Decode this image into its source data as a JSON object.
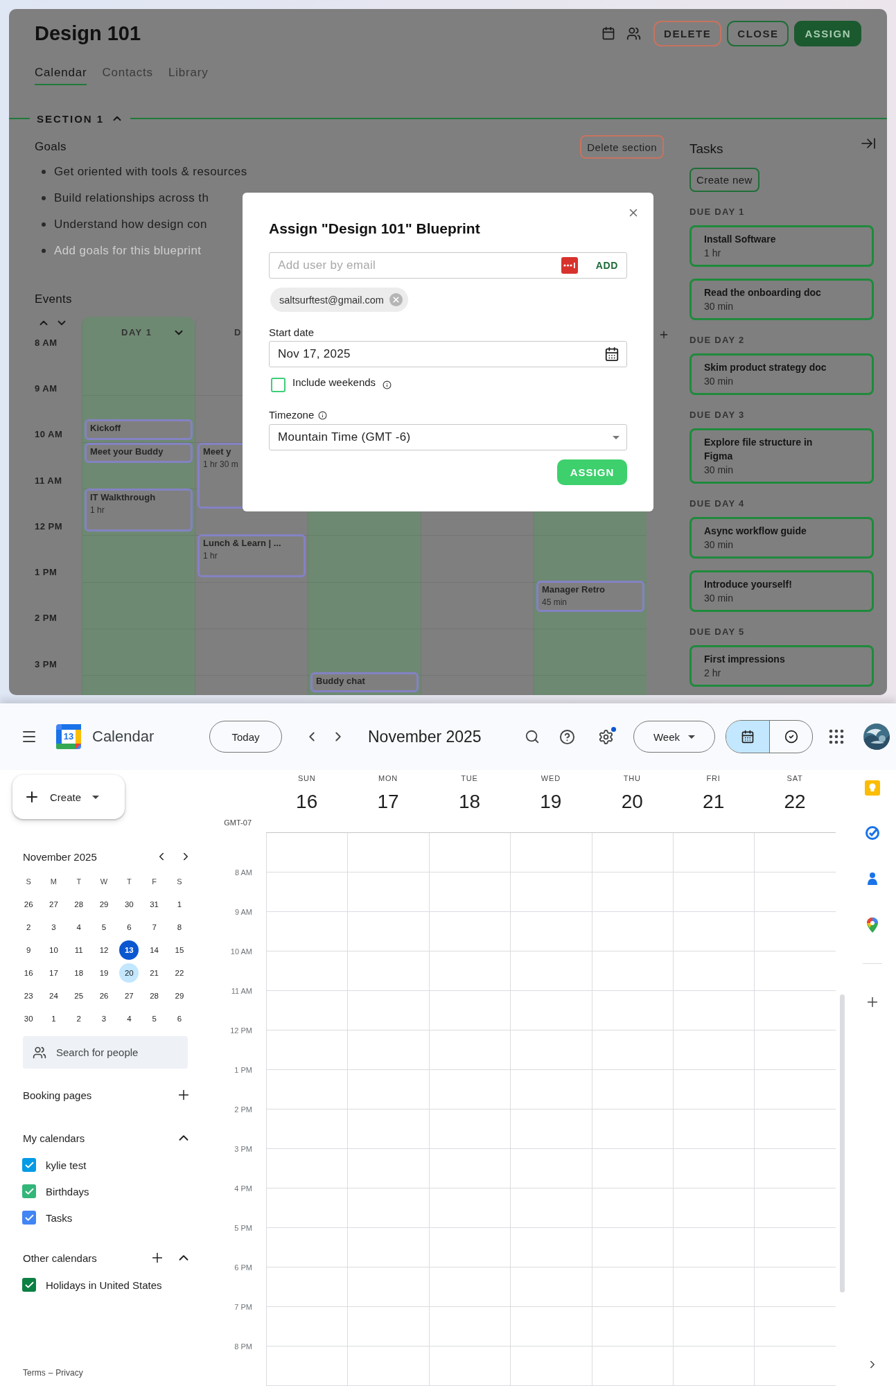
{
  "blueprint": {
    "title": "Design 101",
    "header_buttons": [
      {
        "label": "DELETE",
        "kind": "danger"
      },
      {
        "label": "CLOSE",
        "kind": "outline"
      },
      {
        "label": "ASSIGN",
        "kind": "primary"
      }
    ],
    "tabs": [
      {
        "label": "Calendar",
        "selected": true
      },
      {
        "label": "Contacts",
        "selected": false
      },
      {
        "label": "Library",
        "selected": false
      }
    ],
    "section": {
      "title": "SECTION 1",
      "expanded": true,
      "delete_label": "Delete section"
    },
    "goals": {
      "title": "Goals",
      "items": [
        {
          "text": "Get oriented with tools & resources",
          "kind": "goal"
        },
        {
          "text": "Build relationships across th",
          "kind": "goal"
        },
        {
          "text": "Understand how design con",
          "kind": "goal"
        },
        {
          "placeholder": "Add goals for this blueprint",
          "kind": "placeholder"
        }
      ]
    },
    "events": {
      "title": "Events",
      "hours": [
        "8 AM",
        "9 AM",
        "10 AM",
        "11 AM",
        "12 PM",
        "1 PM",
        "2 PM",
        "3 PM"
      ],
      "days": [
        {
          "label": "DAY 1",
          "caret": true,
          "shaded": true,
          "events": [
            {
              "title": "Kickoff"
            },
            {
              "title": "Meet your Buddy"
            },
            {
              "title": "IT Walkthrough",
              "duration": "1 hr"
            }
          ]
        },
        {
          "label": "D",
          "shaded": false,
          "events": [
            {
              "title": "Meet y",
              "duration": "1 hr 30 m"
            },
            {
              "title": "Lunch & Learn | ...",
              "duration": "1 hr"
            }
          ]
        },
        {
          "shaded": true,
          "events": [
            {
              "title": "Buddy chat"
            }
          ]
        },
        {
          "shaded": false
        },
        {
          "shaded": true,
          "events": [
            {
              "title": "Manager Retro",
              "duration": "45 min"
            }
          ]
        }
      ]
    },
    "tasks": {
      "title": "Tasks",
      "create_label": "Create new",
      "groups": [
        {
          "label": "DUE DAY 1",
          "tasks": [
            {
              "title": "Install Software",
              "duration": "1 hr"
            },
            {
              "title": "Read the onboarding doc",
              "duration": "30 min"
            }
          ]
        },
        {
          "label": "DUE DAY 2",
          "tasks": [
            {
              "title": "Skim product strategy doc",
              "duration": "30 min"
            }
          ]
        },
        {
          "label": "DUE DAY 3",
          "tasks": [
            {
              "title": "Explore file structure in Figma",
              "duration": "30 min"
            }
          ]
        },
        {
          "label": "DUE DAY 4",
          "tasks": [
            {
              "title": "Async workflow guide",
              "duration": "30 min"
            },
            {
              "title": "Introduce yourself!",
              "duration": "30 min"
            }
          ]
        },
        {
          "label": "DUE DAY 5",
          "tasks": [
            {
              "title": "First impressions",
              "duration": "2 hr"
            }
          ]
        }
      ]
    }
  },
  "dialog": {
    "title": "Assign \"Design 101\" Blueprint",
    "email": {
      "placeholder": "Add user by email",
      "action": "ADD"
    },
    "chips": [
      {
        "label": "saltsurftest@gmail.com"
      }
    ],
    "start_date": {
      "label": "Start date",
      "value": "Nov 17, 2025"
    },
    "weekends": {
      "label": "Include weekends",
      "checked": false
    },
    "timezone": {
      "label": "Timezone",
      "value": "Mountain Time (GMT -6)"
    },
    "submit": "ASSIGN"
  },
  "calendar": {
    "app_name": "Calendar",
    "logo_date": "13",
    "today": "Today",
    "period": "November 2025",
    "settings_badge": true,
    "view": "Week",
    "view_toggle": [
      {
        "kind": "calendar",
        "selected": true
      },
      {
        "kind": "tasks",
        "selected": false
      }
    ],
    "create": "Create",
    "mini": {
      "title": "November 2025",
      "weekdays": [
        "S",
        "M",
        "T",
        "W",
        "T",
        "F",
        "S"
      ],
      "weeks": [
        [
          {
            "day": "26",
            "today": false,
            "selected": false
          },
          {
            "day": "27",
            "today": false,
            "selected": false
          },
          {
            "day": "28",
            "today": false,
            "selected": false
          },
          {
            "day": "29",
            "today": false,
            "selected": false
          },
          {
            "day": "30",
            "today": false,
            "selected": false
          },
          {
            "day": "31",
            "today": false,
            "selected": false
          },
          {
            "day": "1",
            "today": false,
            "selected": false
          }
        ],
        [
          {
            "day": "2",
            "today": false,
            "selected": false
          },
          {
            "day": "3",
            "today": false,
            "selected": false
          },
          {
            "day": "4",
            "today": false,
            "selected": false
          },
          {
            "day": "5",
            "today": false,
            "selected": false
          },
          {
            "day": "6",
            "today": false,
            "selected": false
          },
          {
            "day": "7",
            "today": false,
            "selected": false
          },
          {
            "day": "8",
            "today": false,
            "selected": false
          }
        ],
        [
          {
            "day": "9",
            "today": false,
            "selected": false
          },
          {
            "day": "10",
            "today": false,
            "selected": false
          },
          {
            "day": "11",
            "today": false,
            "selected": false
          },
          {
            "day": "12",
            "today": false,
            "selected": false
          },
          {
            "day": "13",
            "today": true,
            "selected": false
          },
          {
            "day": "14",
            "today": false,
            "selected": false
          },
          {
            "day": "15",
            "today": false,
            "selected": false
          }
        ],
        [
          {
            "day": "16",
            "today": false,
            "selected": false
          },
          {
            "day": "17",
            "today": false,
            "selected": false
          },
          {
            "day": "18",
            "today": false,
            "selected": false
          },
          {
            "day": "19",
            "today": false,
            "selected": false
          },
          {
            "day": "20",
            "today": false,
            "selected": true
          },
          {
            "day": "21",
            "today": false,
            "selected": false
          },
          {
            "day": "22",
            "today": false,
            "selected": false
          }
        ],
        [
          {
            "day": "23",
            "today": false,
            "selected": false
          },
          {
            "day": "24",
            "today": false,
            "selected": false
          },
          {
            "day": "25",
            "today": false,
            "selected": false
          },
          {
            "day": "26",
            "today": false,
            "selected": false
          },
          {
            "day": "27",
            "today": false,
            "selected": false
          },
          {
            "day": "28",
            "today": false,
            "selected": false
          },
          {
            "day": "29",
            "today": false,
            "selected": false
          }
        ],
        [
          {
            "day": "30",
            "today": false,
            "selected": false
          },
          {
            "day": "1",
            "today": false,
            "selected": false
          },
          {
            "day": "2",
            "today": false,
            "selected": false
          },
          {
            "day": "3",
            "today": false,
            "selected": false
          },
          {
            "day": "4",
            "today": false,
            "selected": false
          },
          {
            "day": "5",
            "today": false,
            "selected": false
          },
          {
            "day": "6",
            "today": false,
            "selected": false
          }
        ]
      ]
    },
    "search_people": {
      "placeholder": "Search for people"
    },
    "booking": "Booking pages",
    "my_calendars": {
      "title": "My calendars",
      "expanded": true,
      "items": [
        {
          "name": "kylie test",
          "checked": true,
          "color": "#039be5"
        },
        {
          "name": "Birthdays",
          "checked": true,
          "color": "#33b679"
        },
        {
          "name": "Tasks",
          "checked": true,
          "color": "#4285f4"
        }
      ]
    },
    "other_calendars": {
      "title": "Other calendars",
      "expanded": true,
      "items": [
        {
          "name": "Holidays in United States",
          "checked": true,
          "color": "#0b8043"
        }
      ]
    },
    "footer": {
      "terms": "Terms",
      "separator": "–",
      "privacy": "Privacy"
    },
    "week": {
      "timezone": "GMT-07",
      "days": [
        {
          "dow": "SUN",
          "date": "16"
        },
        {
          "dow": "MON",
          "date": "17"
        },
        {
          "dow": "TUE",
          "date": "18"
        },
        {
          "dow": "WED",
          "date": "19"
        },
        {
          "dow": "THU",
          "date": "20"
        },
        {
          "dow": "FRI",
          "date": "21"
        },
        {
          "dow": "SAT",
          "date": "22"
        }
      ],
      "hours": [
        "8 AM",
        "9 AM",
        "10 AM",
        "11 AM",
        "12 PM",
        "1 PM",
        "2 PM",
        "3 PM",
        "4 PM",
        "5 PM",
        "6 PM",
        "7 PM",
        "8 PM"
      ]
    }
  }
}
